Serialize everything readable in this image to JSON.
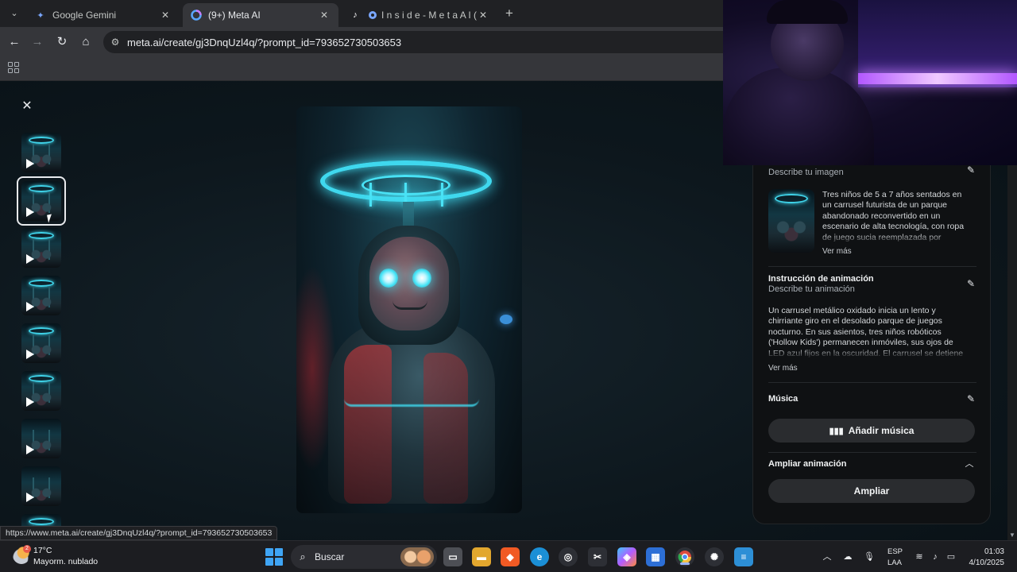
{
  "browser": {
    "tabs": [
      {
        "title": "Google Gemini",
        "icon": "gemini-icon",
        "active": false
      },
      {
        "title": "(9+) Meta AI",
        "icon": "meta-ai-icon",
        "active": true
      },
      {
        "title": "I n s i d e - M e t a A I (@asi",
        "icon": "tiktok-icon",
        "active": false
      }
    ],
    "url": "meta.ai/create/gj3DnqUzl4q/?prompt_id=793652730503653",
    "status_url": "https://www.meta.ai/create/gj3DnqUzl4q/?prompt_id=793652730503653"
  },
  "viewer": {
    "thumbnail_count": 9,
    "selected_thumbnail": 2
  },
  "panel": {
    "image_section": {
      "subtitle": "Describe tu imagen",
      "description": "Tres niños de 5 a 7 años sentados en un carrusel futurista de un parque abandonado reconvertido en un escenario de alta tecnología, con ropa de juego sucia reemplazada por",
      "more": "Ver más"
    },
    "animation_section": {
      "title": "Instrucción de animación",
      "subtitle": "Describe tu animación",
      "description": "Un carrusel metálico oxidado inicia un lento y chirriante giro en el desolado parque de juegos nocturno. En sus asientos, tres niños robóticos ('Hollow Kids') permanecen inmóviles, sus ojos de LED azul fijos en la oscuridad. El carrusel se detiene",
      "more": "Ver más"
    },
    "music_section": {
      "title": "Música",
      "button": "Añadir música"
    },
    "extend_section": {
      "title": "Ampliar animación",
      "button": "Ampliar"
    }
  },
  "taskbar": {
    "weather_temp": "17°C",
    "weather_condition": "Mayorm. nublado",
    "weather_badge": "2",
    "search_placeholder": "Buscar",
    "language_line1": "ESP",
    "language_line2": "LAA",
    "time": "01:03",
    "date": "4/10/2025"
  },
  "colors": {
    "accent_cyan": "#3fd8ee",
    "panel_bg": "#0f1113",
    "button_bg": "#2a2c2f"
  }
}
